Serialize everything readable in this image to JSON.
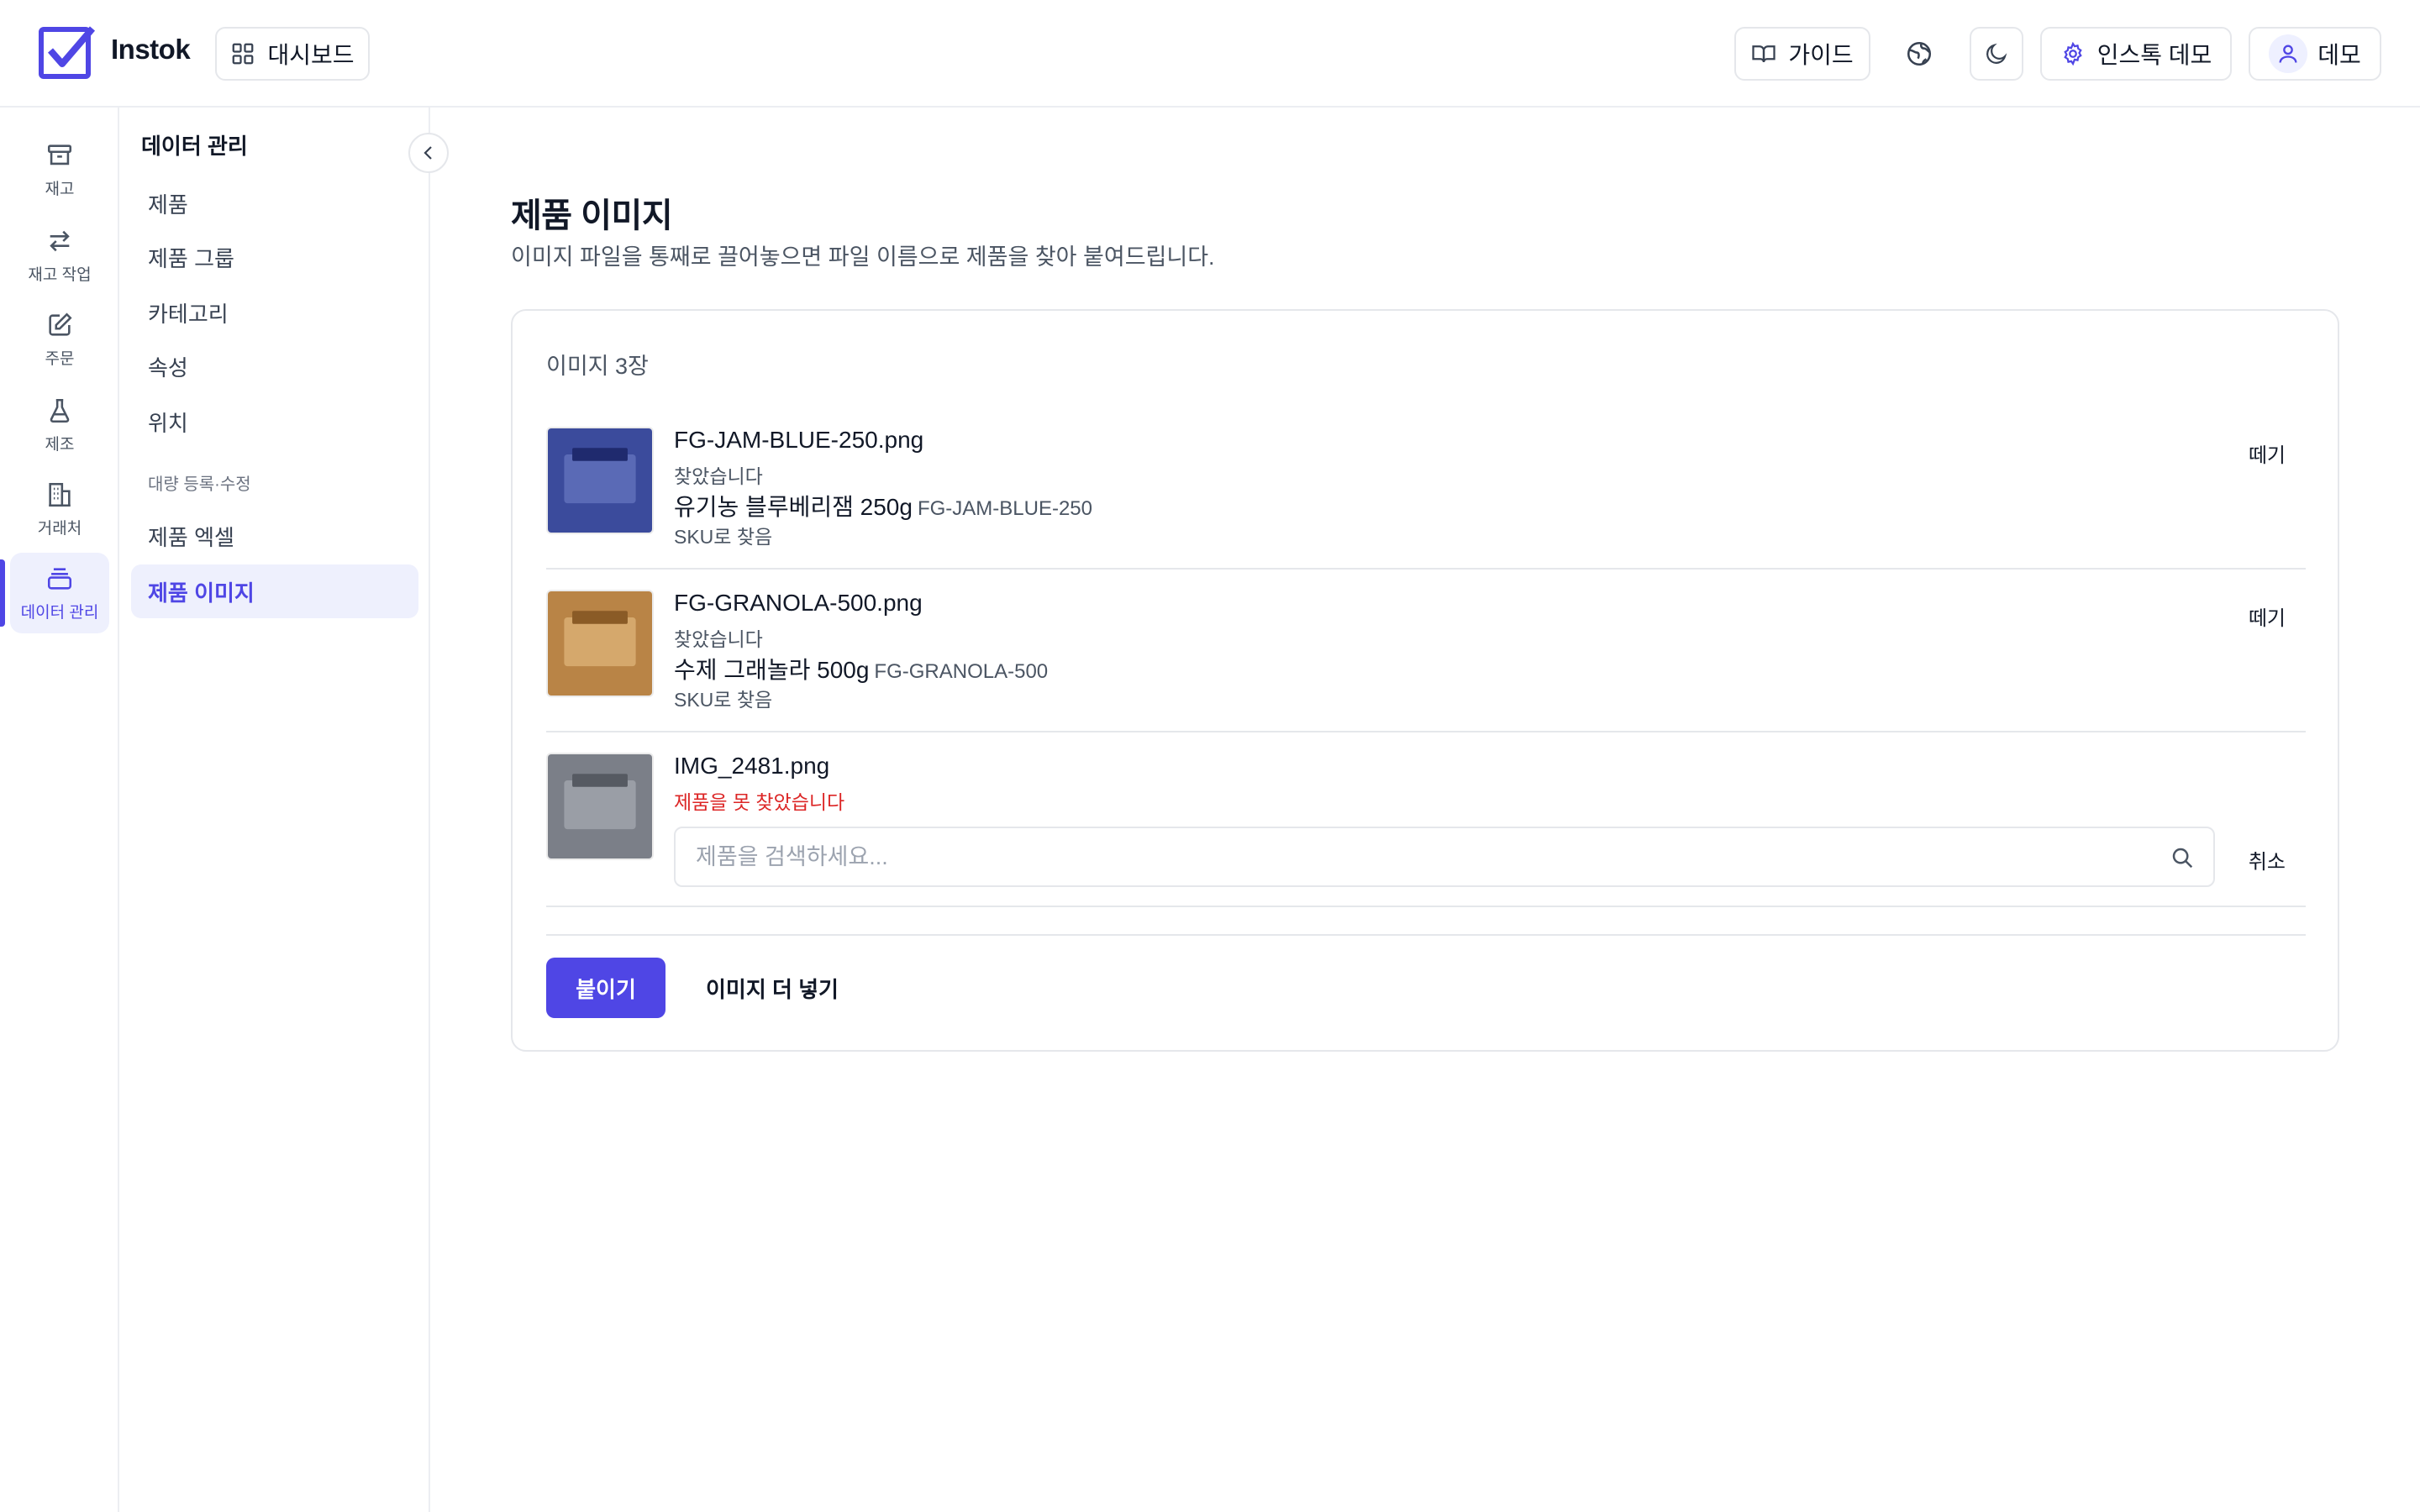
{
  "header": {
    "brand": "Instok",
    "dashboard_label": "대시보드",
    "guide_label": "가이드",
    "org_label": "인스톡 데모",
    "user_label": "데모",
    "icons": {
      "logo": "checkbox-logo-icon",
      "dashboard": "grid-icon",
      "guide": "book-open-icon",
      "globe": "globe-icon",
      "theme": "moon-icon",
      "org": "gear-icon",
      "user": "user-icon"
    }
  },
  "rail": {
    "items": [
      {
        "label": "재고",
        "icon": "archive-box-icon"
      },
      {
        "label": "재고 작업",
        "icon": "arrows-swap-icon"
      },
      {
        "label": "주문",
        "icon": "pencil-square-icon"
      },
      {
        "label": "제조",
        "icon": "flask-icon"
      },
      {
        "label": "거래처",
        "icon": "building-icon"
      },
      {
        "label": "데이터 관리",
        "icon": "stack-icon",
        "active": true
      }
    ]
  },
  "subnav": {
    "title": "데이터 관리",
    "items": [
      {
        "label": "제품"
      },
      {
        "label": "제품 그룹"
      },
      {
        "label": "카테고리"
      },
      {
        "label": "속성"
      },
      {
        "label": "위치"
      }
    ],
    "section_label": "대량 등록·수정",
    "bulk_items": [
      {
        "label": "제품 엑셀"
      },
      {
        "label": "제품 이미지",
        "active": true
      }
    ]
  },
  "main": {
    "title": "제품 이미지",
    "subtitle": "이미지 파일을 통째로 끌어놓으면 파일 이름으로 제품을 찾아 붙여드립니다.",
    "count_label": "이미지 3장",
    "rows": [
      {
        "filename": "FG-JAM-BLUE-250.png",
        "status": "찾았습니다",
        "product_name": "유기농 블루베리잼 250g",
        "sku": "FG-JAM-BLUE-250",
        "match": "SKU로 찾음",
        "action": "떼기",
        "thumb_color": "#3b4b9c"
      },
      {
        "filename": "FG-GRANOLA-500.png",
        "status": "찾았습니다",
        "product_name": "수제 그래놀라 500g",
        "sku": "FG-GRANOLA-500",
        "match": "SKU로 찾음",
        "action": "떼기",
        "thumb_color": "#b98446"
      },
      {
        "filename": "IMG_2481.png",
        "status": "제품을 못 찾았습니다",
        "search_placeholder": "제품을 검색하세요...",
        "action": "취소",
        "thumb_color": "#7b7f88"
      }
    ],
    "attach_label": "붙이기",
    "add_more_label": "이미지 더 넣기"
  },
  "colors": {
    "accent": "#4f46e5",
    "error": "#dc2626"
  }
}
